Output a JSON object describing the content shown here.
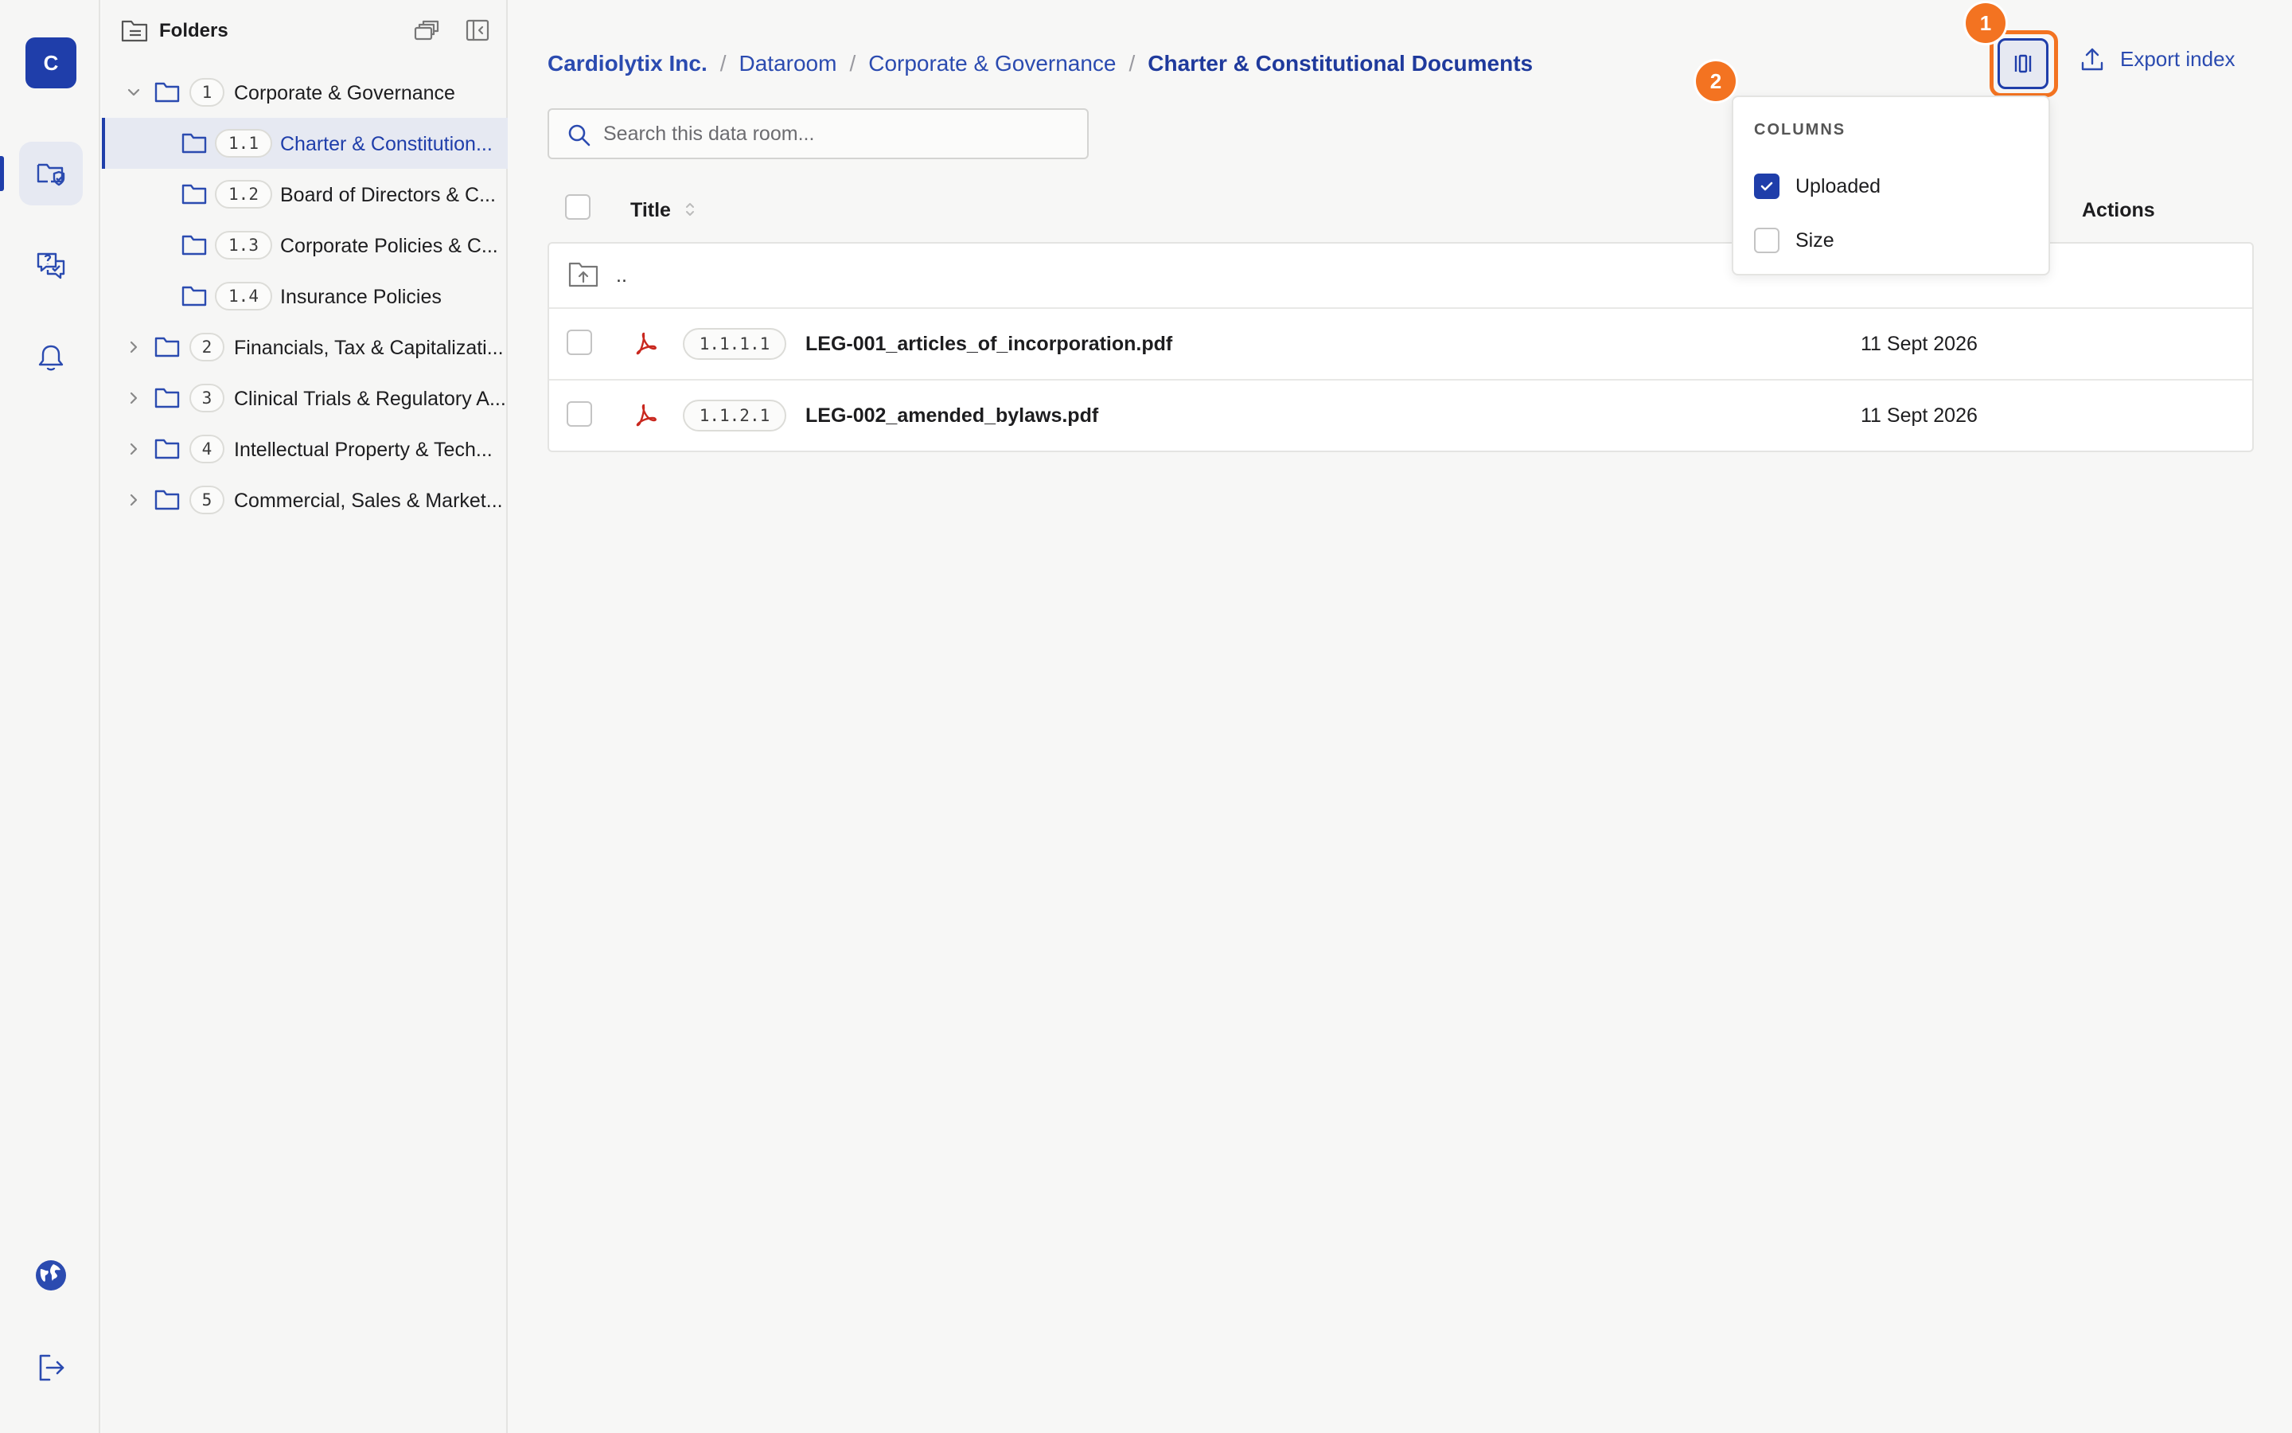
{
  "rail": {
    "avatar_letter": "C",
    "items": [
      {
        "icon": "folder-shield-icon"
      },
      {
        "icon": "chat-check-icon"
      },
      {
        "icon": "bell-icon"
      }
    ],
    "bottom_items": [
      {
        "icon": "globe-icon"
      },
      {
        "icon": "logout-icon"
      }
    ]
  },
  "sidebar": {
    "title": "Folders",
    "tree": [
      {
        "num": "1",
        "label": "Corporate & Governance",
        "expanded": true,
        "level": 0
      },
      {
        "num": "1.1",
        "label": "Charter & Constitution...",
        "level": 1,
        "selected": true
      },
      {
        "num": "1.2",
        "label": "Board of Directors & C...",
        "level": 1
      },
      {
        "num": "1.3",
        "label": "Corporate Policies & C...",
        "level": 1
      },
      {
        "num": "1.4",
        "label": "Insurance Policies",
        "level": 1
      },
      {
        "num": "2",
        "label": "Financials, Tax & Capitalizati...",
        "level": 0
      },
      {
        "num": "3",
        "label": "Clinical Trials & Regulatory A...",
        "level": 0
      },
      {
        "num": "4",
        "label": "Intellectual Property & Tech...",
        "level": 0
      },
      {
        "num": "5",
        "label": "Commercial, Sales & Market...",
        "level": 0
      }
    ]
  },
  "breadcrumb": {
    "items": [
      "Cardiolytix Inc.",
      "Dataroom",
      "Corporate & Governance",
      "Charter & Constitutional Documents"
    ],
    "separator": "/"
  },
  "toolbar": {
    "export_label": "Export index",
    "badge_1": "1",
    "badge_2": "2"
  },
  "search": {
    "placeholder": "Search this data room..."
  },
  "table": {
    "headers": {
      "title": "Title",
      "actions": "Actions"
    },
    "parent_row_label": "..",
    "rows": [
      {
        "num": "1.1.1.1",
        "name": "LEG-001_articles_of_incorporation.pdf",
        "uploaded": "11 Sept 2026"
      },
      {
        "num": "1.1.2.1",
        "name": "LEG-002_amended_bylaws.pdf",
        "uploaded": "11 Sept 2026"
      }
    ]
  },
  "columns_menu": {
    "heading": "COLUMNS",
    "options": [
      {
        "label": "Uploaded",
        "checked": true
      },
      {
        "label": "Size",
        "checked": false
      }
    ]
  },
  "colors": {
    "accent": "#1f3eaa",
    "highlight": "#f37321",
    "pdf": "#c9281f"
  }
}
